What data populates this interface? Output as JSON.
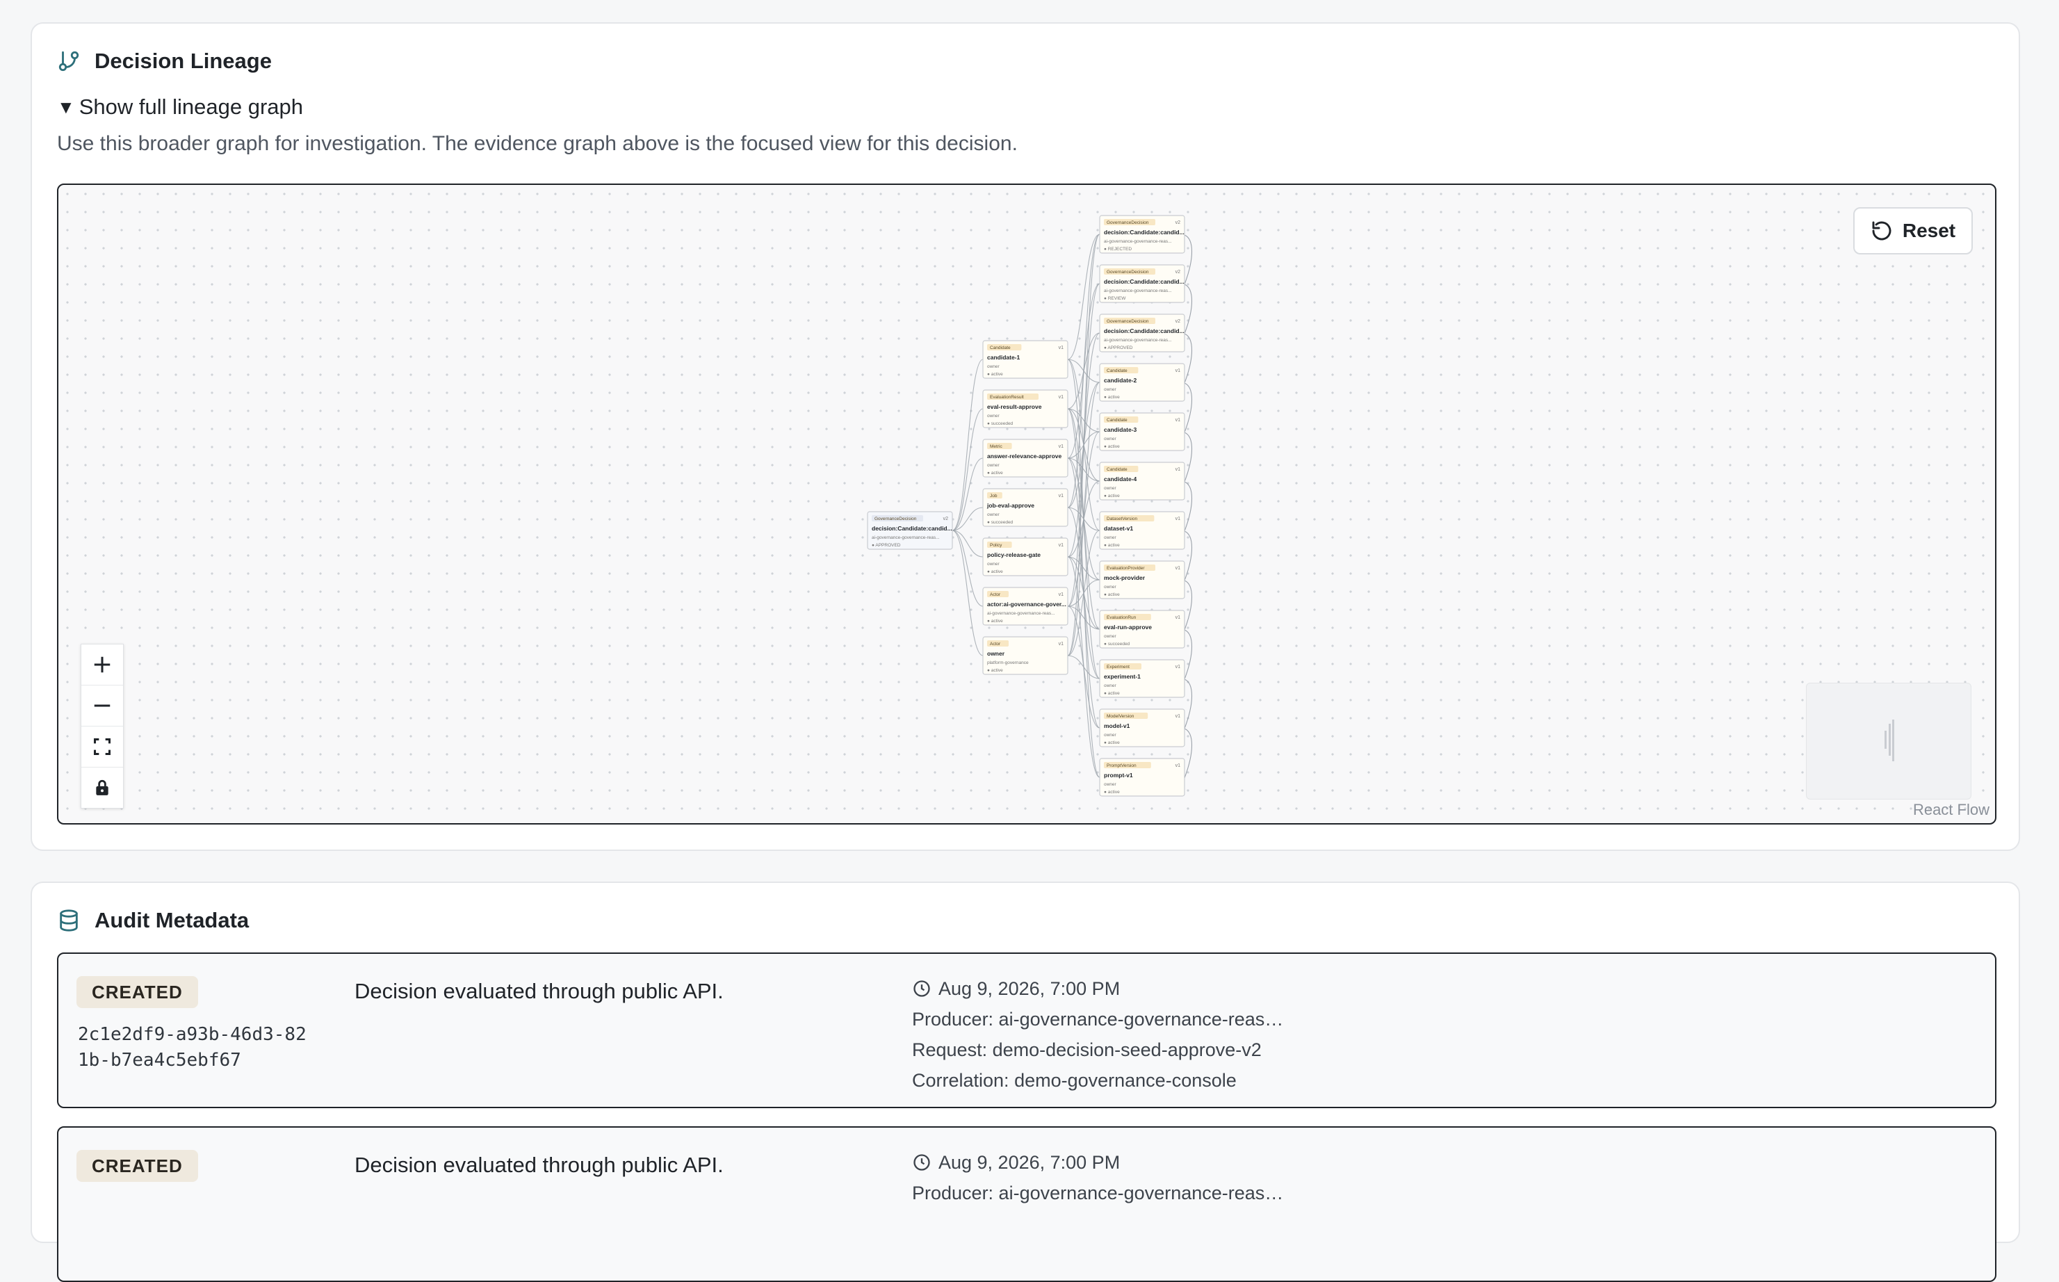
{
  "lineage": {
    "title": "Decision Lineage",
    "summary": "Show full lineage graph",
    "hint": "Use this broader graph for investigation. The evidence graph above is the focused view for this decision.",
    "reset_label": "Reset",
    "attribution": "React Flow",
    "graph": {
      "root": {
        "type": "GovernanceDecision",
        "name": "decision:Candidate:candid...",
        "sub": "ai-governance-governance-reas...",
        "status": "APPROVED",
        "version": "v2"
      },
      "middle": [
        {
          "type": "Candidate",
          "name": "candidate-1",
          "sub": "owner",
          "status": "active",
          "version": "v1"
        },
        {
          "type": "EvaluationResult",
          "name": "eval-result-approve",
          "sub": "owner",
          "status": "succeeded",
          "version": "v1"
        },
        {
          "type": "Metric",
          "name": "answer-relevance-approve",
          "sub": "owner",
          "status": "active",
          "version": "v1"
        },
        {
          "type": "Job",
          "name": "job-eval-approve",
          "sub": "owner",
          "status": "succeeded",
          "version": "v1"
        },
        {
          "type": "Policy",
          "name": "policy-release-gate",
          "sub": "owner",
          "status": "active",
          "version": "v1"
        },
        {
          "type": "Actor",
          "name": "actor:ai-governance-gover...",
          "sub": "ai-governance-governance-reas...",
          "status": "active",
          "version": "v1"
        },
        {
          "type": "Actor",
          "name": "owner",
          "sub": "platform-governance",
          "status": "active",
          "version": "v1"
        }
      ],
      "right": [
        {
          "type": "GovernanceDecision",
          "name": "decision:Candidate:candid...",
          "sub": "ai-governance-governance-reas...",
          "status": "REJECTED",
          "version": "v2"
        },
        {
          "type": "GovernanceDecision",
          "name": "decision:Candidate:candid...",
          "sub": "ai-governance-governance-reas...",
          "status": "REVIEW",
          "version": "v2"
        },
        {
          "type": "GovernanceDecision",
          "name": "decision:Candidate:candid...",
          "sub": "ai-governance-governance-reas...",
          "status": "APPROVED",
          "version": "v2"
        },
        {
          "type": "Candidate",
          "name": "candidate-2",
          "sub": "owner",
          "status": "active",
          "version": "v1"
        },
        {
          "type": "Candidate",
          "name": "candidate-3",
          "sub": "owner",
          "status": "active",
          "version": "v1"
        },
        {
          "type": "Candidate",
          "name": "candidate-4",
          "sub": "owner",
          "status": "active",
          "version": "v1"
        },
        {
          "type": "DatasetVersion",
          "name": "dataset-v1",
          "sub": "owner",
          "status": "active",
          "version": "v1"
        },
        {
          "type": "EvaluationProvider",
          "name": "mock-provider",
          "sub": "owner",
          "status": "active",
          "version": "v1"
        },
        {
          "type": "EvaluationRun",
          "name": "eval-run-approve",
          "sub": "owner",
          "status": "succeeded",
          "version": "v1"
        },
        {
          "type": "Experiment",
          "name": "experiment-1",
          "sub": "owner",
          "status": "active",
          "version": "v1"
        },
        {
          "type": "ModelVersion",
          "name": "model-v1",
          "sub": "owner",
          "status": "active",
          "version": "v1"
        },
        {
          "type": "PromptVersion",
          "name": "prompt-v1",
          "sub": "owner",
          "status": "active",
          "version": "v1"
        }
      ]
    }
  },
  "audit": {
    "title": "Audit Metadata",
    "records": [
      {
        "badge": "CREATED",
        "id": "2c1e2df9-a93b-46d3-821b-b7ea4c5ebf67",
        "message": "Decision evaluated through public API.",
        "time": "Aug 9, 2026, 7:00 PM",
        "producer": "Producer: ai-governance-governance-reaso...",
        "request": "Request: demo-decision-seed-approve-v2",
        "correlation": "Correlation: demo-governance-console"
      },
      {
        "badge": "CREATED",
        "id": "",
        "message": "Decision evaluated through public API.",
        "time": "Aug 9, 2026, 7:00 PM",
        "producer": "Producer: ai-governance-governance-reaso...",
        "request": "",
        "correlation": ""
      }
    ]
  },
  "colors": {
    "node_bg": "#fffdf6",
    "tag_bg": "#f8e7c4",
    "root_tag_bg": "#e4e8f1",
    "edge": "#9aa1a9"
  }
}
